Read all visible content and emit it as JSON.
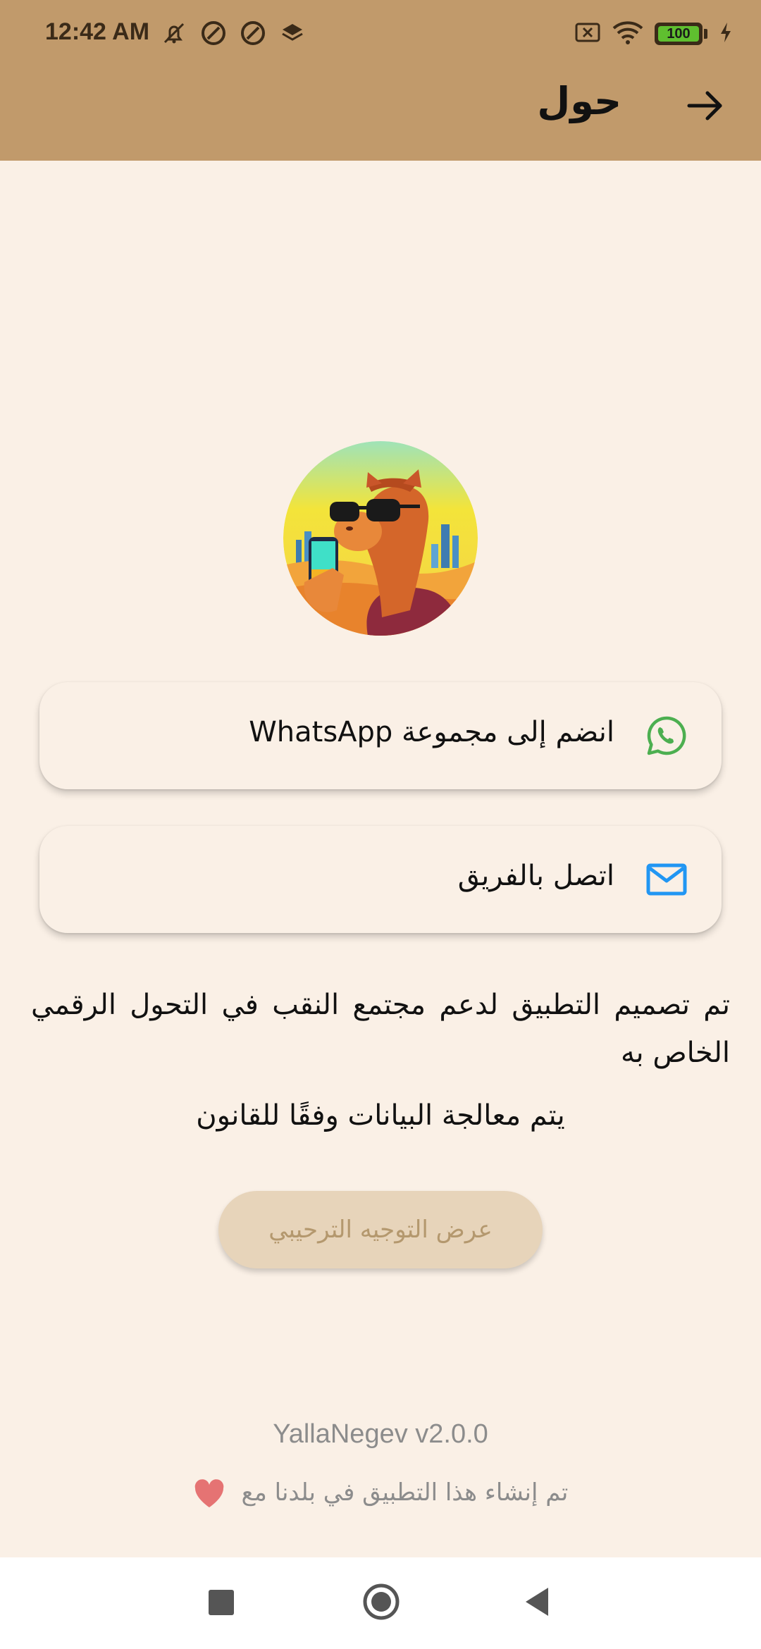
{
  "status_bar": {
    "time": "12:42 AM",
    "battery": "100"
  },
  "app_bar": {
    "title": "حول"
  },
  "cards": [
    {
      "label": "انضم إلى مجموعة WhatsApp",
      "icon": "whatsapp-icon"
    },
    {
      "label": "اتصل بالفريق",
      "icon": "mail-icon"
    }
  ],
  "description": "تم تصميم التطبيق لدعم مجتمع النقب في التحول الرقمي الخاص به",
  "legal_text": "يتم معالجة البيانات وفقًا للقانون",
  "onboarding_button": "عرض التوجيه الترحيبي",
  "version": "YallaNegev v2.0.0",
  "made_with": "تم إنشاء هذا التطبيق في بلدنا مع",
  "colors": {
    "app_bar": "#C19A6B",
    "background": "#FAF0E6",
    "whatsapp": "#4CAF50",
    "mail": "#2196F3",
    "heart": "#E57373"
  }
}
